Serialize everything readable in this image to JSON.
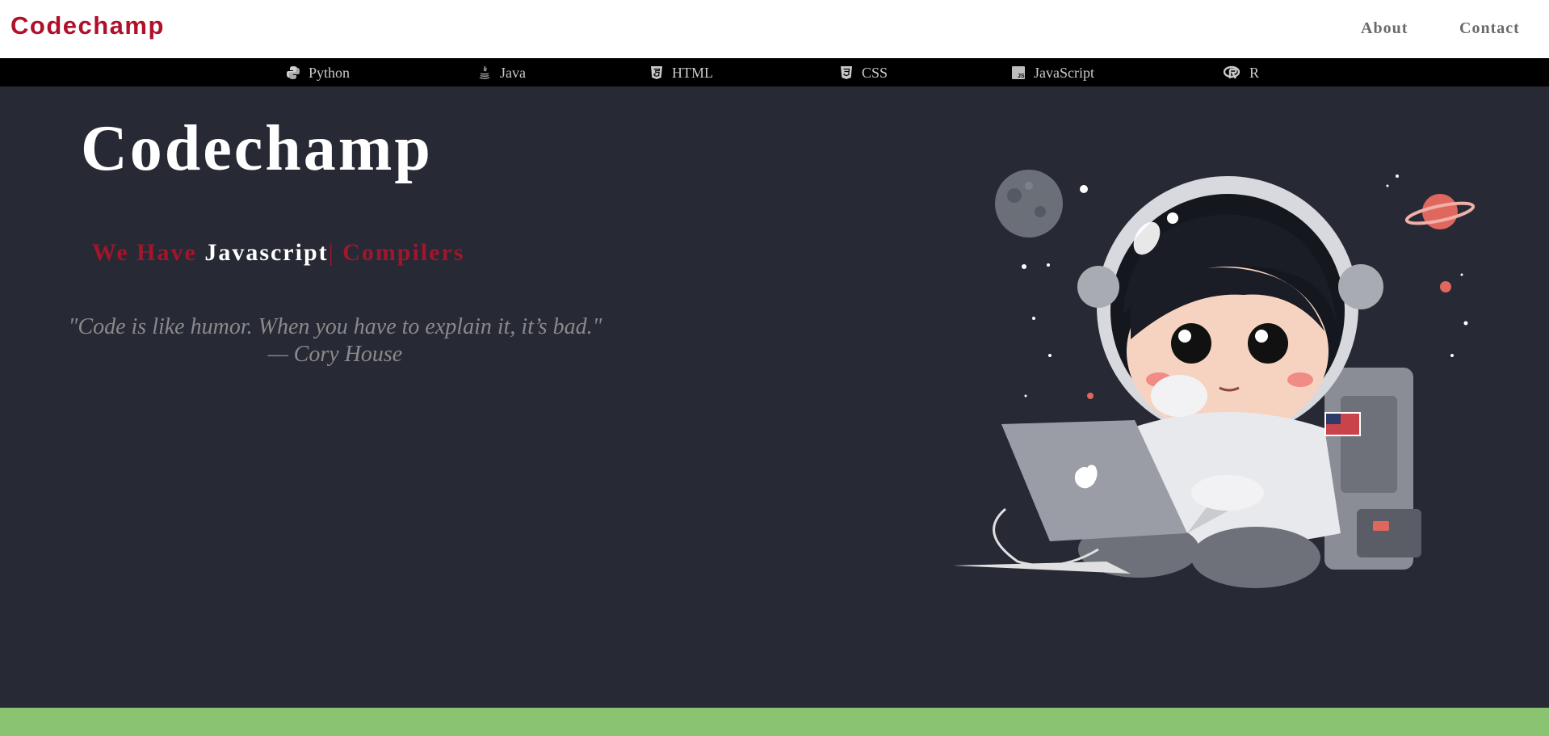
{
  "header": {
    "brand": "Codechamp",
    "nav": [
      {
        "label": "About"
      },
      {
        "label": "Contact"
      }
    ]
  },
  "languages": [
    {
      "label": "Python",
      "icon": "python-icon"
    },
    {
      "label": "Java",
      "icon": "java-icon"
    },
    {
      "label": "HTML",
      "icon": "html5-icon"
    },
    {
      "label": "CSS",
      "icon": "css3-icon"
    },
    {
      "label": "JavaScript",
      "icon": "javascript-icon"
    },
    {
      "label": "R",
      "icon": "r-language-icon"
    }
  ],
  "hero": {
    "title": "Codechamp",
    "tagline_prefix": "We Have ",
    "tagline_highlight": "Javascript",
    "tagline_cursor": "|",
    "tagline_suffix": " Compilers",
    "quote_text": "\"Code is like humor. When you have to explain it, it’s bad.\"",
    "quote_author": "— Cory House"
  },
  "illustration": {
    "subject": "astronaut-child-with-laptop"
  },
  "colors": {
    "brand": "#b0102a",
    "background": "#272935",
    "langbar": "#000000",
    "footer_strip": "#8bc471"
  }
}
